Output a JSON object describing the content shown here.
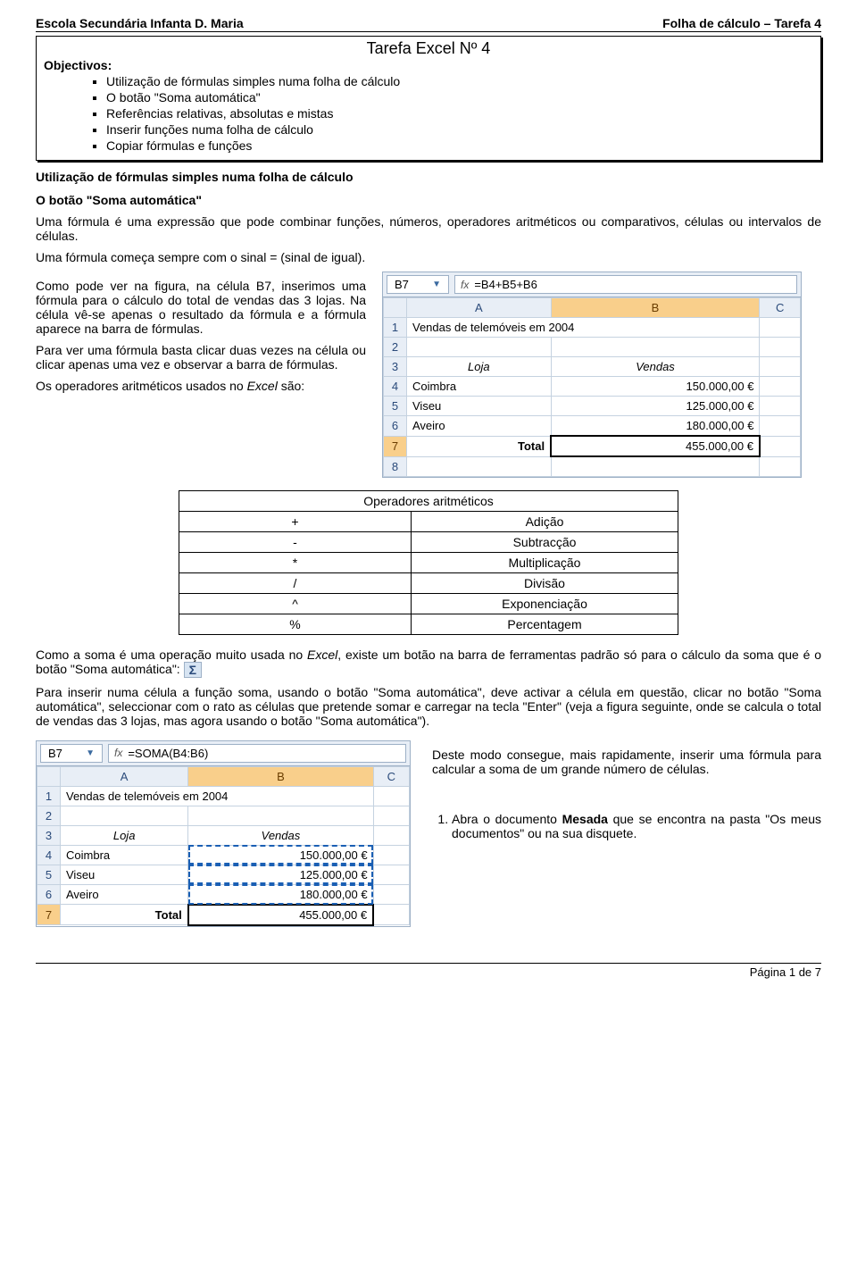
{
  "header": {
    "left": "Escola Secundária Infanta D. Maria",
    "right": "Folha de cálculo – Tarefa 4"
  },
  "titlebox": {
    "title": "Tarefa Excel Nº 4",
    "obj_label": "Objectivos:",
    "items": [
      "Utilização de fórmulas simples numa folha de cálculo",
      "O botão \"Soma automática\"",
      "Referências relativas, absolutas e mistas",
      "Inserir funções numa folha de cálculo",
      "Copiar fórmulas e funções"
    ]
  },
  "section1": {
    "h1": "Utilização de fórmulas simples numa folha de cálculo",
    "h2": "O botão \"Soma automática\"",
    "p1": "Uma fórmula é uma expressão que pode combinar funções, números, operadores aritméticos ou comparativos, células ou intervalos de células.",
    "p2": "Uma fórmula começa sempre com o sinal = (sinal de igual).",
    "p3": "Como pode ver na figura, na célula B7, inserimos uma fórmula para o cálculo do total de vendas das 3 lojas. Na célula vê-se apenas o resultado da fórmula e a fórmula aparece na barra de fórmulas.",
    "p4": "Para ver uma fórmula basta clicar duas vezes na célula ou clicar apenas uma vez e observar a barra de fórmulas.",
    "p5a": "Os operadores aritméticos usados no ",
    "p5b": "Excel",
    "p5c": " são:"
  },
  "excel1": {
    "namebox": "B7",
    "formula": "=B4+B5+B6",
    "cols": [
      "A",
      "B",
      "C"
    ],
    "rows": [
      {
        "n": "1",
        "a": "Vendas de telemóveis em 2004",
        "span": true
      },
      {
        "n": "2",
        "a": "",
        "b": ""
      },
      {
        "n": "3",
        "a": "Loja",
        "b": "Vendas",
        "ital": true
      },
      {
        "n": "4",
        "a": "Coimbra",
        "b": "150.000,00 €"
      },
      {
        "n": "5",
        "a": "Viseu",
        "b": "125.000,00 €"
      },
      {
        "n": "6",
        "a": "Aveiro",
        "b": "180.000,00 €"
      },
      {
        "n": "7",
        "a": "Total",
        "b": "455.000,00 €",
        "total": true,
        "sel": true
      },
      {
        "n": "8",
        "a": "",
        "b": ""
      }
    ]
  },
  "ops": {
    "title": "Operadores aritméticos",
    "rows": [
      {
        "sym": "+",
        "desc": "Adição"
      },
      {
        "sym": "-",
        "desc": "Subtracção"
      },
      {
        "sym": "*",
        "desc": "Multiplicação"
      },
      {
        "sym": "/",
        "desc": "Divisão"
      },
      {
        "sym": "^",
        "desc": "Exponenciação"
      },
      {
        "sym": "%",
        "desc": "Percentagem"
      }
    ]
  },
  "para2a": "Como a soma é uma operação muito usada no ",
  "para2b": "Excel",
  "para2c": ", existe um botão na barra de ferramentas padrão só para o cálculo da soma que é o botão \"Soma automática\": ",
  "para3": "Para inserir numa célula a função soma, usando o botão \"Soma automática\", deve activar a célula em questão, clicar no botão \"Soma automática\", seleccionar com o rato as células que pretende somar e carregar na tecla \"Enter\" (veja a figura seguinte, onde se calcula o total de vendas das 3 lojas, mas agora usando o botão \"Soma automática\").",
  "excel2": {
    "namebox": "B7",
    "formula": "=SOMA(B4:B6)",
    "cols": [
      "A",
      "B",
      "C"
    ],
    "rows": [
      {
        "n": "1",
        "a": "Vendas de telemóveis em 2004",
        "span": true
      },
      {
        "n": "2",
        "a": "",
        "b": ""
      },
      {
        "n": "3",
        "a": "Loja",
        "b": "Vendas",
        "ital": true
      },
      {
        "n": "4",
        "a": "Coimbra",
        "b": "150.000,00 €",
        "marq": true
      },
      {
        "n": "5",
        "a": "Viseu",
        "b": "125.000,00 €",
        "marq": true
      },
      {
        "n": "6",
        "a": "Aveiro",
        "b": "180.000,00 €",
        "marq": true
      },
      {
        "n": "7",
        "a": "Total",
        "b": "455.000,00 €",
        "total": true,
        "sel": true
      }
    ]
  },
  "right2": {
    "p1": "Deste modo consegue, mais rapidamente, inserir uma fórmula para calcular a soma de um grande número de células.",
    "step1a": "Abra o documento ",
    "step1b": "Mesada",
    "step1c": " que se encontra na pasta \"Os meus documentos\" ou na sua disquete."
  },
  "footer": "Página 1 de 7",
  "fx_label": "fx",
  "sigma": "Σ"
}
